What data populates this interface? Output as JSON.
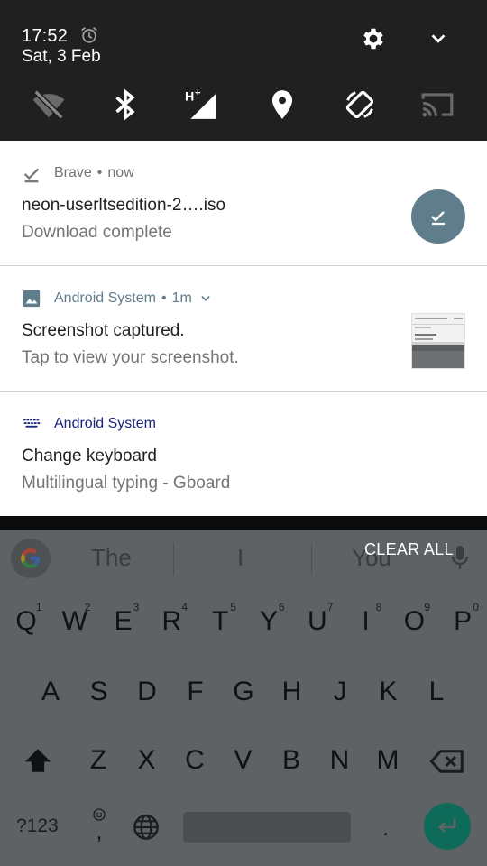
{
  "status": {
    "time": "17:52",
    "date": "Sat, 3 Feb"
  },
  "quick_settings": {
    "tiles": [
      "wifi-off",
      "bluetooth",
      "mobile-data-h-plus",
      "location",
      "auto-rotate",
      "cast"
    ]
  },
  "notifications": [
    {
      "app": "Brave",
      "meta": "now",
      "title": "neon-userltsedition-2….iso",
      "subtitle": "Download complete",
      "icon": "download-icon",
      "action_icon": "download-done-icon",
      "accent": "#607d8b"
    },
    {
      "app": "Android System",
      "meta": "1m",
      "title": "Screenshot captured.",
      "subtitle": "Tap to view your screenshot.",
      "icon": "image-icon",
      "accent": "#607d8b"
    },
    {
      "app": "Android System",
      "meta": "",
      "title": "Change keyboard",
      "subtitle": "Multilingual typing - Gboard",
      "icon": "keyboard-icon",
      "accent": "#1a237e"
    }
  ],
  "keyboard": {
    "suggestions": [
      "The",
      "I",
      "You"
    ],
    "clear_all": "CLEAR ALL",
    "row1": [
      "Q",
      "W",
      "E",
      "R",
      "T",
      "Y",
      "U",
      "I",
      "O",
      "P"
    ],
    "row1_hints": [
      "1",
      "2",
      "3",
      "4",
      "5",
      "6",
      "7",
      "8",
      "9",
      "0"
    ],
    "row2": [
      "A",
      "S",
      "D",
      "F",
      "G",
      "H",
      "J",
      "K",
      "L"
    ],
    "row3": [
      "Z",
      "X",
      "C",
      "V",
      "B",
      "N",
      "M"
    ],
    "symbols_label": "?123",
    "comma": ",",
    "period": "."
  }
}
